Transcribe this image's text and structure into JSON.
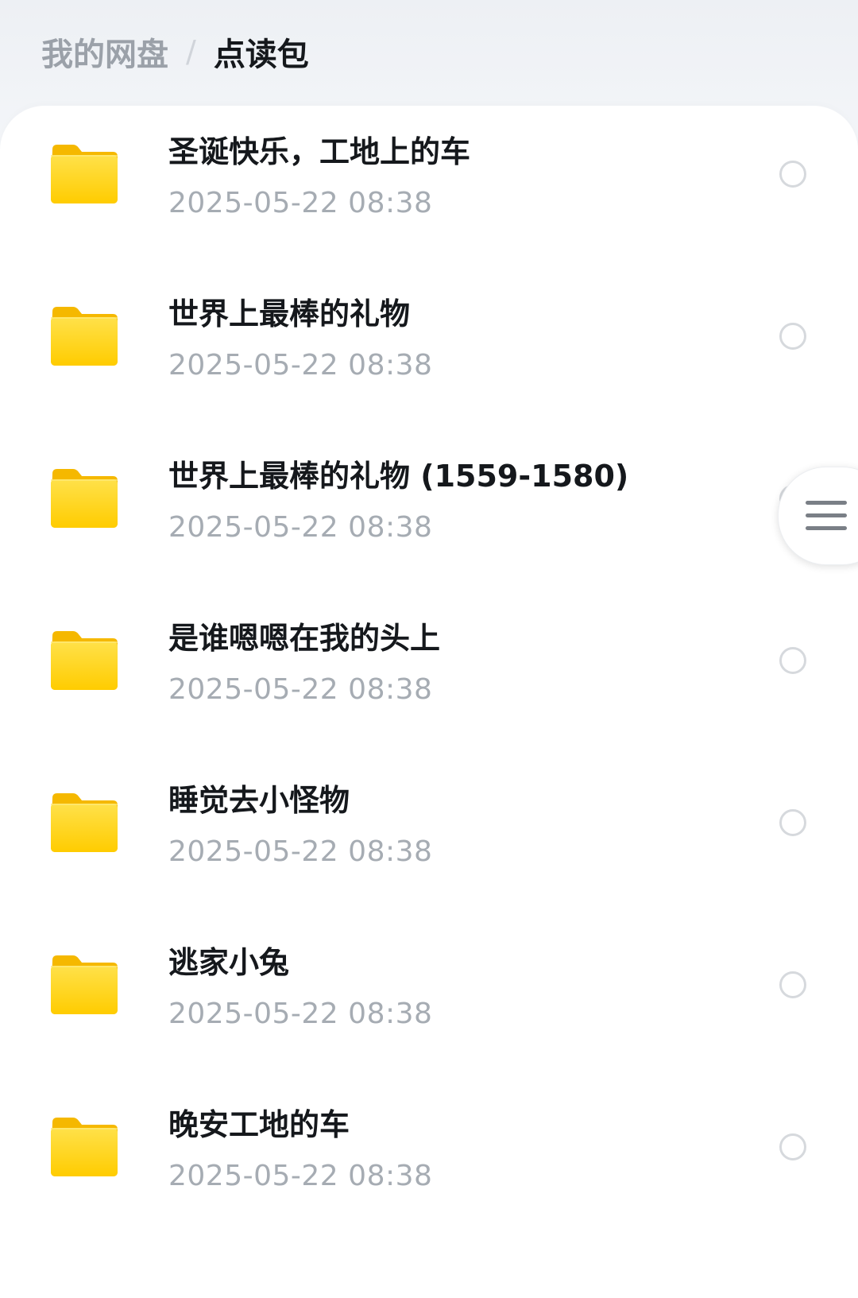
{
  "breadcrumb": {
    "root": "我的网盘",
    "separator": "/",
    "current": "点读包"
  },
  "colors": {
    "folder_yellow": "#ffd21f",
    "folder_yellow_dark": "#f5b800",
    "title_text": "#15181c",
    "meta_text": "#a6acb3"
  },
  "folders": [
    {
      "name": "圣诞快乐，工地上的车",
      "date": "2025-05-22  08:38",
      "icon": "folder-icon",
      "selected": false
    },
    {
      "name": "世界上最棒的礼物",
      "date": "2025-05-22  08:38",
      "icon": "folder-icon",
      "selected": false
    },
    {
      "name": "世界上最棒的礼物 (1559-1580)",
      "date": "2025-05-22  08:38",
      "icon": "folder-icon",
      "selected": false
    },
    {
      "name": "是谁嗯嗯在我的头上",
      "date": "2025-05-22  08:38",
      "icon": "folder-icon",
      "selected": false
    },
    {
      "name": "睡觉去小怪物",
      "date": "2025-05-22  08:38",
      "icon": "folder-icon",
      "selected": false
    },
    {
      "name": "逃家小兔",
      "date": "2025-05-22  08:38",
      "icon": "folder-icon",
      "selected": false
    },
    {
      "name": "晚安工地的车",
      "date": "2025-05-22  08:38",
      "icon": "folder-icon",
      "selected": false
    }
  ],
  "floating_menu": {
    "icon": "menu-icon"
  }
}
